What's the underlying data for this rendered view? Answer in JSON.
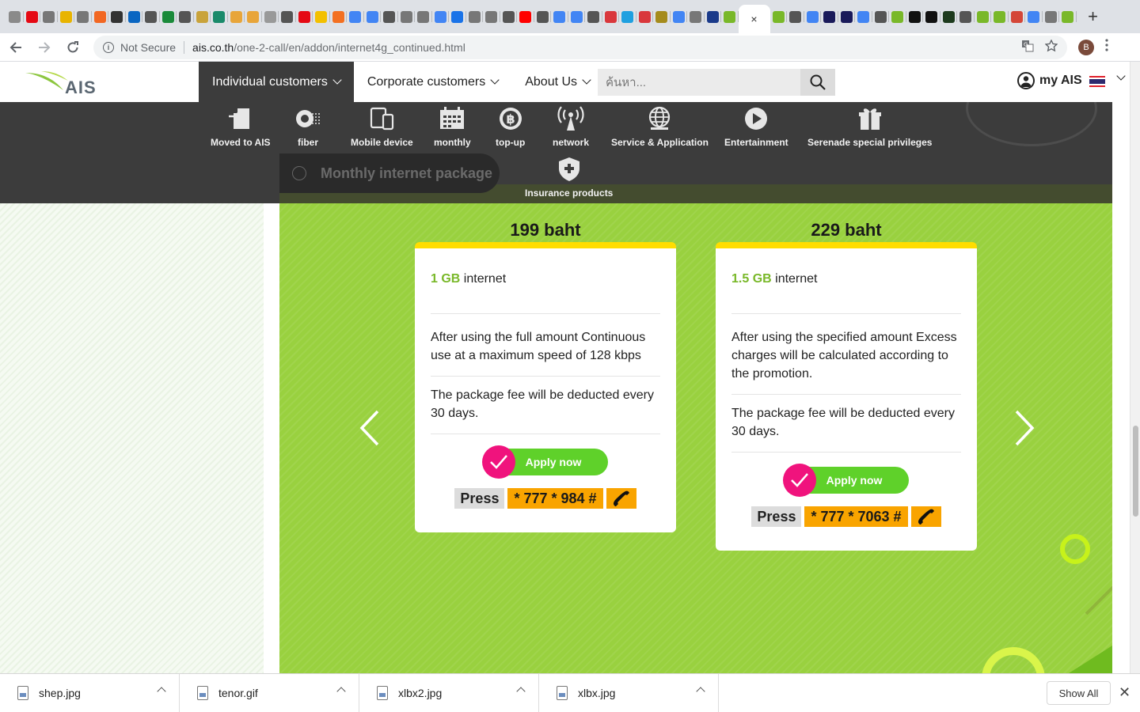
{
  "browser": {
    "tab_favicon_colors": [
      "#8a8a8a",
      "#e50914",
      "#777777",
      "#e8b400",
      "#777777",
      "#f26722",
      "#333333",
      "#0a66c2",
      "#555555",
      "#1a8a3a",
      "#555555",
      "#c9a33b",
      "#1a8a6a",
      "#e8a53a",
      "#e8a53a",
      "#999999",
      "#555555",
      "#e50914",
      "#f3c000",
      "#f37021",
      "#4285f4",
      "#4285f4",
      "#555555",
      "#777777",
      "#777777",
      "#4285f4",
      "#1a73e8",
      "#777777",
      "#777777",
      "#555555",
      "#ff0000",
      "#555555",
      "#4285f4",
      "#4285f4",
      "#555555",
      "#d9373c",
      "#1fa0e0",
      "#d9373c",
      "#a58b1c",
      "#4285f4",
      "#777777",
      "#1a3a8a",
      "#79b829"
    ],
    "tab_favicon_colors_after": [
      "#79b829",
      "#555555",
      "#4285f4",
      "#1a1a5a",
      "#1a1a5a",
      "#4285f4",
      "#555555",
      "#79b829",
      "#111111",
      "#111111",
      "#1d3a1d",
      "#555555",
      "#79b829",
      "#79b829",
      "#d44638",
      "#4285f4",
      "#777777",
      "#79b829"
    ],
    "active_tab_close": "×",
    "new_tab": "+",
    "address": {
      "security_label": "Not Secure",
      "host": "ais.co.th",
      "path": "/one-2-call/en/addon/internet4g_continued.html"
    },
    "profile_initial": "B"
  },
  "header": {
    "logo_text": "AIS",
    "nav": [
      {
        "label": "Individual customers",
        "active": true
      },
      {
        "label": "Corporate customers",
        "active": false
      },
      {
        "label": "About Us",
        "active": false
      }
    ],
    "search_placeholder": "ค้นหา...",
    "my_ais": "my AIS"
  },
  "categories": {
    "items": [
      {
        "label": "Moved to AIS",
        "icon": "move-to-ais-icon"
      },
      {
        "label": "fiber",
        "icon": "fiber-icon"
      },
      {
        "label": "Mobile device",
        "icon": "mobile-device-icon"
      },
      {
        "label": "monthly",
        "icon": "calendar-icon"
      },
      {
        "label": "top-up",
        "icon": "baht-coin-icon"
      },
      {
        "label": "network",
        "icon": "antenna-icon"
      },
      {
        "label": "Service & Application",
        "icon": "globe-icon"
      },
      {
        "label": "Entertainment",
        "icon": "play-icon"
      },
      {
        "label": "Serenade special privileges",
        "icon": "gift-icon"
      }
    ],
    "insurance": {
      "label": "Insurance products",
      "icon": "shield-plus-icon"
    },
    "current_pill": "Monthly internet package"
  },
  "packages": [
    {
      "price": "199 baht",
      "amount": "1 GB",
      "amount_suffix": " internet",
      "after_use": "After using the full amount Continuous use at a maximum speed of 128 kbps",
      "fee": "The package fee will be deducted every 30 days.",
      "apply": "Apply now",
      "press": "Press",
      "code": "* 777 * 984 #"
    },
    {
      "price": "229 baht",
      "amount": "1.5 GB",
      "amount_suffix": " internet",
      "after_use": "After using the specified amount Excess charges will be calculated according to the promotion.",
      "fee": "The package fee will be deducted every 30 days.",
      "apply": "Apply now",
      "press": "Press",
      "code": "* 777 * 7063 #"
    }
  ],
  "colors": {
    "panel_green": "#99d13f",
    "highlight_green": "#79b829",
    "card_top": "#ffdd00",
    "apply_green": "#5fd12a",
    "check_pink": "#f0137d",
    "code_orange": "#f9a400",
    "dark_bar": "#3c3c3c"
  },
  "downloads": {
    "files": [
      "shep.jpg",
      "tenor.gif",
      "xlbx2.jpg",
      "xlbx.jpg"
    ],
    "show_all": "Show All"
  }
}
